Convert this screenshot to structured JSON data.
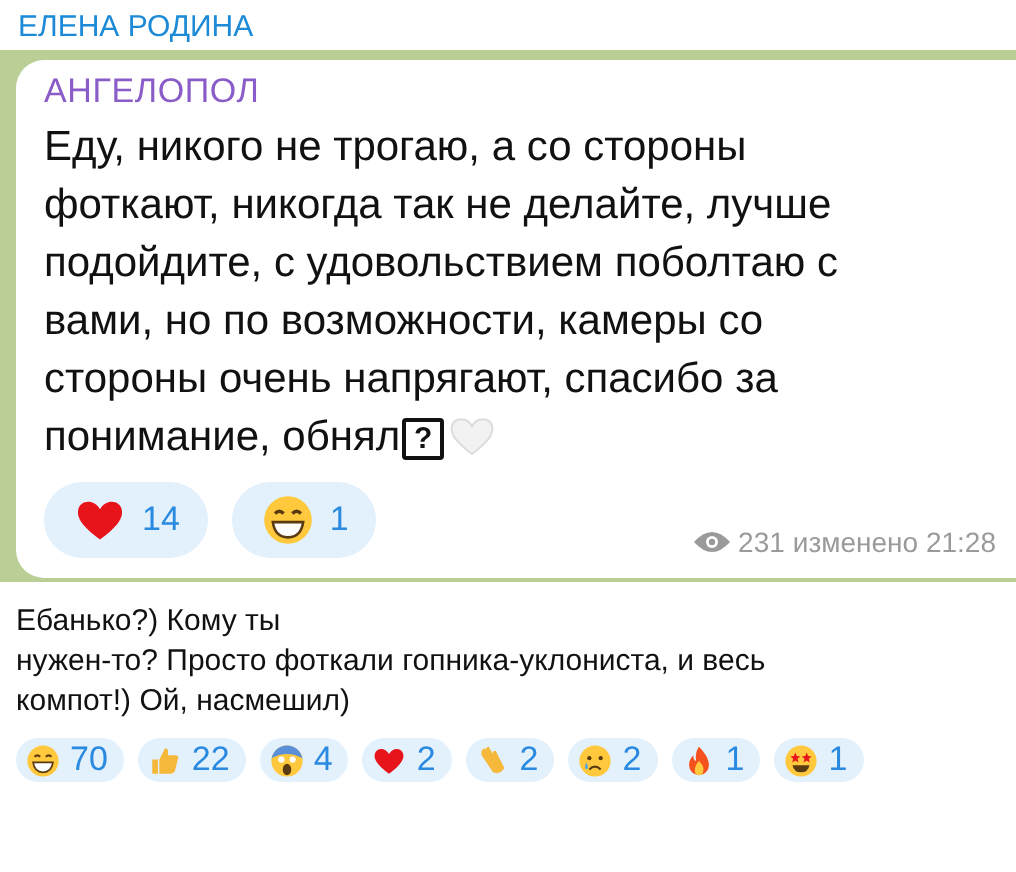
{
  "author": "ЕЛЕНА РОДИНА",
  "quoted_post": {
    "channel": "АНГЕЛОПОЛ",
    "lines": [
      "Еду, никого не трогаю, а со стороны",
      "фоткают, никогда так не делайте, лучше",
      "подойдите, с удовольствием поболтаю с",
      "вами, но по возможности, камеры со",
      "стороны очень напрягают, спасибо за",
      "понимание, обнял"
    ],
    "missing_glyph": "?",
    "reactions": [
      {
        "kind": "heart",
        "count": "14"
      },
      {
        "kind": "grin",
        "count": "1"
      }
    ],
    "views": "231",
    "edited": "изменено 21:28"
  },
  "comment": {
    "lines": [
      "Ебанько?) Кому ты",
      "нужен-то? Просто фоткали гопника-уклониста, и весь",
      "компот!) Ой, насмешил)"
    ],
    "reactions": [
      {
        "kind": "grin",
        "count": "70"
      },
      {
        "kind": "thumbs",
        "count": "22"
      },
      {
        "kind": "scream",
        "count": "4"
      },
      {
        "kind": "heart",
        "count": "2"
      },
      {
        "kind": "clap",
        "count": "2"
      },
      {
        "kind": "cry",
        "count": "2"
      },
      {
        "kind": "fire",
        "count": "1"
      },
      {
        "kind": "star",
        "count": "1"
      }
    ]
  }
}
